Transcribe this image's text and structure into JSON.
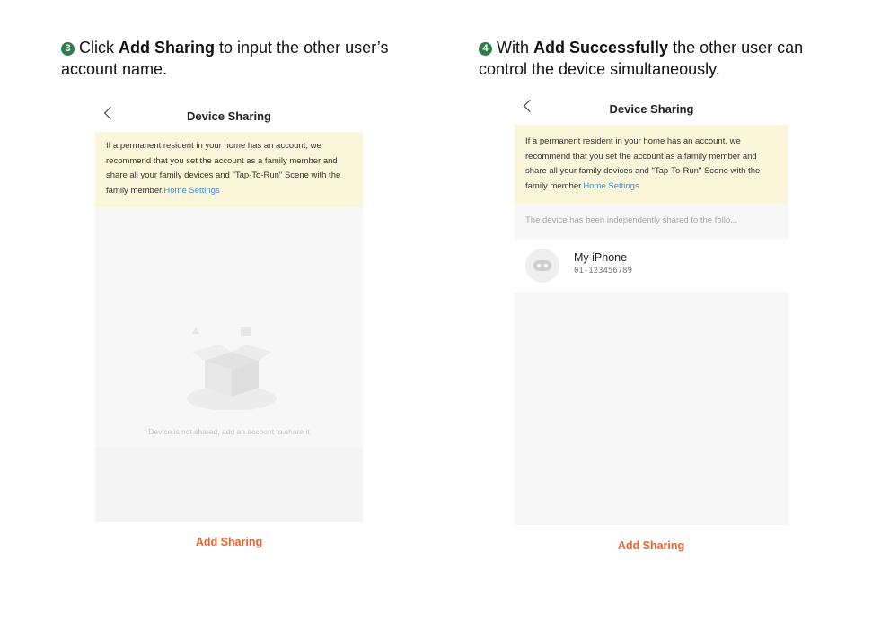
{
  "step3": {
    "number": "3",
    "prefix": "Click ",
    "bold": "Add Sharing",
    "suffix": " to input the other user’s account name."
  },
  "step4": {
    "number": "4",
    "prefix": "With ",
    "bold": "Add Successfully",
    "suffix": " the other user can control the device simultaneously."
  },
  "screen1": {
    "title": "Device Sharing",
    "notice_text": "If a permanent resident in your home has an account, we recommend that you set the account as a family member and share all your family devices and \"Tap-To-Run\" Scene with the family member.",
    "notice_link": "Home Settings",
    "empty_text": "Device is not shared, add an account to share it",
    "add_button": "Add Sharing",
    "empty_icon": "open-box-icon"
  },
  "screen2": {
    "title": "Device Sharing",
    "notice_text": "If a permanent resident in your home has an account, we recommend that you set the account as a family member and share all your family devices and \"Tap-To-Run\" Scene with the family member.",
    "notice_link": "Home Settings",
    "shared_note": "The device has been independently shared to the follo...",
    "device_name": "My iPhone",
    "device_id": "01-123456789",
    "add_button": "Add Sharing",
    "avatar_icon": "robot-face-icon"
  },
  "colors": {
    "accent": "#f0602c",
    "notice_bg": "#fbf6d9",
    "link": "#3b8fe0",
    "step_badge": "#2e7d4f"
  }
}
